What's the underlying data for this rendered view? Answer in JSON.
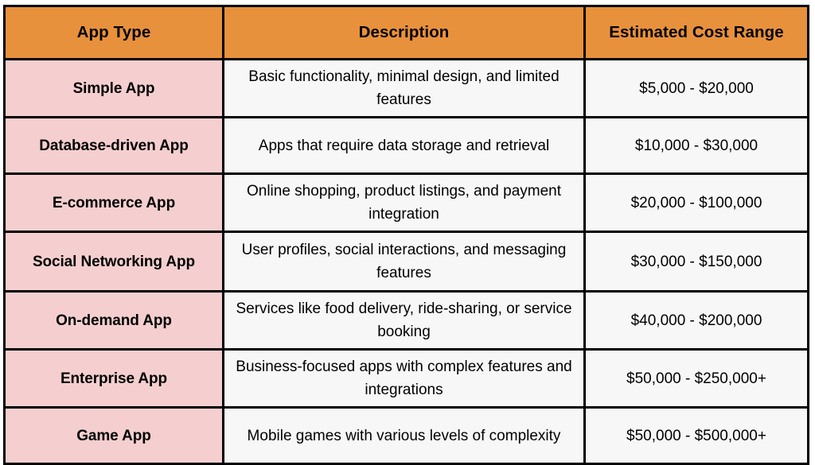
{
  "table": {
    "columns": [
      {
        "key": "app_type",
        "label": "App Type"
      },
      {
        "key": "description",
        "label": "Description"
      },
      {
        "key": "cost",
        "label": "Estimated Cost Range"
      }
    ],
    "rows": [
      {
        "app_type": "Simple App",
        "description": "Basic functionality, minimal design, and limited features",
        "cost": "$5,000 - $20,000"
      },
      {
        "app_type": "Database-driven App",
        "description": "Apps that require data storage and retrieval",
        "cost": "$10,000 - $30,000"
      },
      {
        "app_type": "E-commerce App",
        "description": "Online shopping, product listings, and payment integration",
        "cost": "$20,000 - $100,000"
      },
      {
        "app_type": "Social Networking App",
        "description": "User profiles, social interactions, and messaging features",
        "cost": "$30,000 - $150,000"
      },
      {
        "app_type": "On-demand App",
        "description": "Services like food delivery, ride-sharing, or service booking",
        "cost": "$40,000 - $200,000"
      },
      {
        "app_type": "Enterprise App",
        "description": "Business-focused apps with complex features and integrations",
        "cost": "$50,000 - $250,000+"
      },
      {
        "app_type": "Game App",
        "description": "Mobile games with various levels of complexity",
        "cost": "$50,000 - $500,000+"
      }
    ]
  },
  "colors": {
    "header_background": "#e8913c",
    "app_type_background": "#f5cfcf",
    "cell_background": "#f7f7f7",
    "border": "#000000",
    "text": "#000000"
  }
}
